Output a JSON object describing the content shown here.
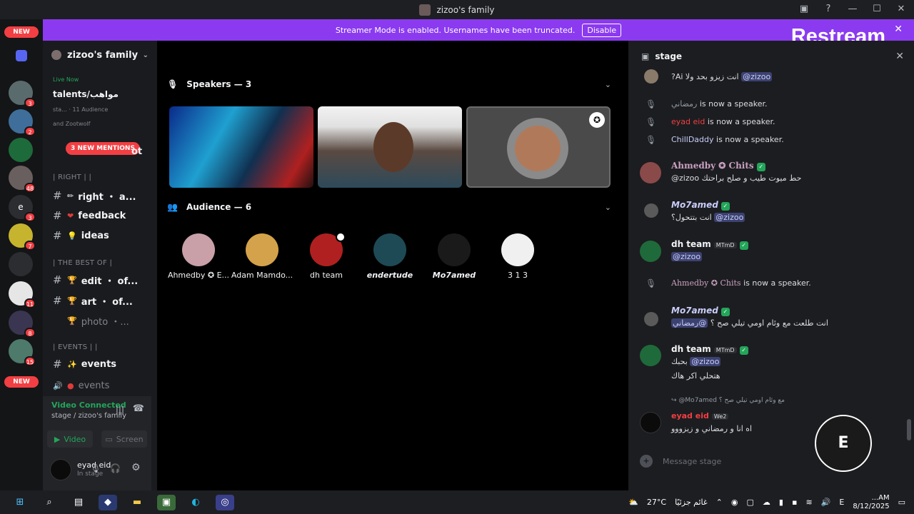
{
  "window": {
    "title": "zizoo's family"
  },
  "banner": {
    "text": "Streamer Mode is enabled. Usernames have been truncated.",
    "disable_label": "Disable"
  },
  "watermark": {
    "text": "Restream"
  },
  "rail": {
    "new_top": "NEW",
    "new_bottom": "NEW",
    "badges": [
      "3",
      "2",
      "48",
      "3",
      "7",
      "11",
      "8",
      "15"
    ]
  },
  "sidebar": {
    "guild_name": "zizoo's family",
    "live_label": "Live Now",
    "live_channel": "talents/مواهب",
    "live_sub1": "sta... · 11 Audience",
    "live_sub2": "and Zootwolf",
    "mentions_pill": "3 NEW MENTIONS",
    "channel_partial": "ot",
    "category_right": "| RIGHT | |",
    "channels_right": [
      {
        "emoji": "✏",
        "name": "right ・ a..."
      },
      {
        "emoji": "❤",
        "name": "feedback"
      },
      {
        "emoji": "💡",
        "name": "ideas"
      }
    ],
    "category_best": "| THE BEST OF |",
    "channels_best": [
      {
        "emoji": "🏆",
        "name": "edit ・ of..."
      },
      {
        "emoji": "🏆",
        "name": "art ・ of..."
      },
      {
        "emoji": "🏆",
        "name": "photo ・..."
      }
    ],
    "category_events": "| EVENTS | |",
    "channel_events": {
      "emoji": "✨",
      "name": "events"
    },
    "voice_events": "events"
  },
  "voice": {
    "status": "Video Connected",
    "sub": "stage / zizoo's family",
    "video_label": "Video",
    "screen_label": "Screen"
  },
  "user": {
    "name": "eyad eid",
    "status": "In stage"
  },
  "stage": {
    "speakers_label": "Speakers — 3",
    "audience_label": "Audience — 6",
    "audience": [
      {
        "name": "Ahmedby ✪ E...",
        "color": "#c9a0a8"
      },
      {
        "name": "Adam Mamdo...",
        "color": "#d4a24a"
      },
      {
        "name": "dh team",
        "color": "#b02020"
      },
      {
        "name": "endertude",
        "color": "#1e4a55"
      },
      {
        "name": "Mo7amed",
        "color": "#1a1a1a"
      },
      {
        "name": "3 1 3",
        "color": "#f0f0f0"
      }
    ]
  },
  "chat": {
    "header": "stage",
    "messages": [
      {
        "kind": "text",
        "text": "?Ai انت زيزو بحد ولا",
        "mention": "@zizoo"
      },
      {
        "kind": "system",
        "who": "رمضاني",
        "text": "is now a speaker."
      },
      {
        "kind": "system",
        "who": "eyad eid",
        "text": "is now a speaker."
      },
      {
        "kind": "system",
        "who": "ChillDaddy",
        "text": "is now a speaker."
      },
      {
        "kind": "user",
        "who": "Ahmedby ✪ Chits",
        "line1": "@zizoo حط ميوت طيب و صلح براحتك"
      },
      {
        "kind": "user",
        "who": "Mo7amed",
        "line1": "انت بتتحول؟",
        "mention": "@zizoo"
      },
      {
        "kind": "user",
        "who": "dh team",
        "tag": "MTmD",
        "line1": "@zizoo"
      },
      {
        "kind": "system",
        "who": "Ahmedby ✪ Chits",
        "text": "is now a speaker."
      },
      {
        "kind": "user",
        "who": "Mo7amed",
        "line1": "انت طلعت مع وئام اومي تيلي صح ؟",
        "mention": "@رمضاني"
      },
      {
        "kind": "user",
        "who": "dh team",
        "tag": "MTmD",
        "line1": "بحبك",
        "mention": "@zizoo",
        "line2": "هتحلي اكر هاك"
      },
      {
        "kind": "reply",
        "reply_text": "مع وئام اومي تيلي صح ؟",
        "reply_to": "@Mo7amed",
        "who": "eyad eid",
        "tag": "We2",
        "line1": "اه انا و رمضاني و زيزووو"
      }
    ],
    "input_placeholder": "Message stage"
  },
  "overlay": {
    "circle_letter": "E"
  },
  "taskbar": {
    "weather": "27°C",
    "weather_desc": "غائم جزئيًا",
    "clock_time": "...AM",
    "clock_date": "8/12/2025",
    "lang": "E"
  }
}
